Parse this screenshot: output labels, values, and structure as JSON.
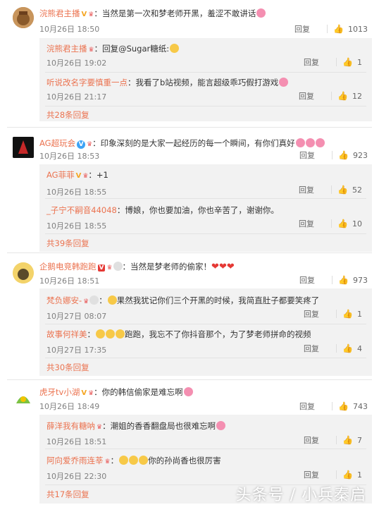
{
  "actions": {
    "reply_label": "回复"
  },
  "comments": [
    {
      "user": "浣熊君主播",
      "user_badge": "V",
      "text": "当然是第一次和梦老师开黑，羞涩不敢讲话",
      "time": "10月26日 18:50",
      "likes": "1013",
      "replies": [
        {
          "user": "浣熊君主播",
          "text": "回复@Sugar糖纸:",
          "time": "10月26日 19:02",
          "likes": "1"
        },
        {
          "user": "听说改名字要慎重一点",
          "text": "我看了b站视频，能言超级乖巧假打游戏",
          "time": "10月26日 21:17",
          "likes": "12"
        }
      ],
      "more": "共28条回复"
    },
    {
      "user": "AG超玩会",
      "user_badge": "V",
      "text": "印象深刻的是大家一起经历的每一个瞬间，有你们真好",
      "time": "10月26日 18:53",
      "likes": "923",
      "replies": [
        {
          "user": "AG菲菲",
          "text": "+1",
          "time": "10月26日 18:55",
          "likes": "52"
        },
        {
          "user": "_子宁不嗣音44048",
          "text": "博娘，你也要加油，你也辛苦了，谢谢你。",
          "time": "10月26日 18:55",
          "likes": "10"
        }
      ],
      "more": "共39条回复"
    },
    {
      "user": "企鹅电竞韩跑跑",
      "user_badge": "V",
      "text": "当然是梦老师的偷家！",
      "time": "10月26日 18:51",
      "likes": "973",
      "replies": [
        {
          "user": "梵负娜安-",
          "text": "果然我犹记你们三个开黑的时候，我简直肚子都要笑疼了",
          "time": "10月27日 08:07",
          "likes": "1"
        },
        {
          "user": "故事何祥美",
          "text": "跑跑，我忘不了你抖音那个，为了梦老师拼命的视频",
          "time": "10月27日 17:35",
          "likes": "4"
        }
      ],
      "more": "共30条回复"
    },
    {
      "user": "虎牙tv小湖",
      "user_badge": "V",
      "text": "你的韩信偷家是难忘啊",
      "time": "10月26日 18:49",
      "likes": "743",
      "replies": [
        {
          "user": "薛洋我有糖呐",
          "text": "潮姐的香香翻盘局也很难忘啊",
          "time": "10月26日 18:51",
          "likes": "7"
        },
        {
          "user": "阿向爱乔雨连莘",
          "text": "你的孙尚香也很厉害",
          "time": "10月26日 22:30",
          "likes": "1"
        }
      ],
      "more": "共17条回复"
    }
  ],
  "watermark": "头条号 / 小兵秦启",
  "colors": {
    "username": "#eb7350",
    "meta": "#808080",
    "subbox_bg": "#f2f2f2",
    "vbadge": "#3ea3f5"
  }
}
